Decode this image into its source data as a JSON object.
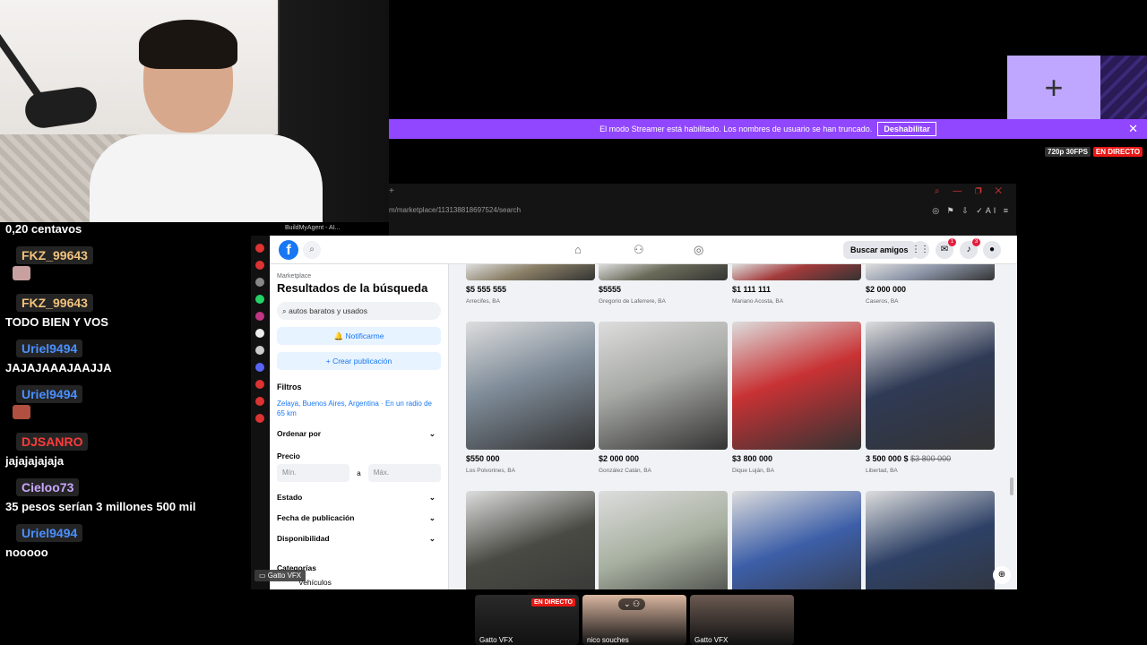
{
  "chat": [
    {
      "type": "msg",
      "text": "0,20 centavos"
    },
    {
      "type": "user",
      "text": "FKZ_99643",
      "color": "#f1c27d"
    },
    {
      "type": "emote",
      "color": "#c9a0a0"
    },
    {
      "type": "user",
      "text": "FKZ_99643",
      "color": "#f1c27d"
    },
    {
      "type": "msg",
      "text": "TODO BIEN Y VOS"
    },
    {
      "type": "user",
      "text": "Uriel9494",
      "color": "#4a90ff"
    },
    {
      "type": "msg",
      "text": "JAJAJAAAJAAJJA"
    },
    {
      "type": "user",
      "text": "Uriel9494",
      "color": "#4a90ff"
    },
    {
      "type": "emote",
      "color": "#b05040"
    },
    {
      "type": "user",
      "text": "DJSANRO",
      "color": "#ff3b3b"
    },
    {
      "type": "msg",
      "text": "jajajajajaja"
    },
    {
      "type": "user",
      "text": "Cieloo73",
      "color": "#c9a7ff"
    },
    {
      "type": "msg",
      "text": "35 pesos serían 3 millones 500 mil"
    },
    {
      "type": "user",
      "text": "Uriel9494",
      "color": "#4a90ff"
    },
    {
      "type": "msg",
      "text": "nooooo"
    }
  ],
  "streamer_bar": {
    "text": "El modo Streamer está habilitado. Los nombres de usuario se han truncado.",
    "button": "Deshabilitar"
  },
  "stream_quality": {
    "resolution": "720p 30FPS",
    "live": "EN DIRECTO"
  },
  "browser": {
    "url": "m/marketplace/113138818697524/search",
    "tab_title": "BuildMyAgent - AI..."
  },
  "facebook": {
    "logo": "f",
    "find_friends": "Buscar amigos",
    "messenger_badge": "1",
    "notif_badge": "3",
    "sidebar": {
      "section": "Marketplace",
      "title": "Resultados de la búsqueda",
      "search_value": "autos baratos y usados",
      "notify_button": "Notificarme",
      "create_button": "+ Crear publicación",
      "filters_label": "Filtros",
      "location": "Zelaya, Buenos Aires, Argentina · En un radio de 65 km",
      "sort_label": "Ordenar por",
      "price_label": "Precio",
      "price_min": "Mín.",
      "price_sep": "a",
      "price_max": "Máx.",
      "condition_label": "Estado",
      "date_label": "Fecha de publicación",
      "availability_label": "Disponibilidad",
      "categories_label": "Categorías",
      "vehicles_label": "Vehículos"
    },
    "listings_row1": [
      {
        "price": "$5 555 555",
        "city": "Arrecifes, BA",
        "color": "#8a7f66"
      },
      {
        "price": "$5555",
        "city": "Gregorio de Laferrere, BA",
        "color": "#6b6b5a"
      },
      {
        "price": "$1 111 111",
        "city": "Mariano Acosta, BA",
        "color": "#a33a3a"
      },
      {
        "price": "$2 000 000",
        "city": "Caseros, BA",
        "color": "#8d96a8"
      }
    ],
    "listings_row2": [
      {
        "price": "$550 000",
        "city": "Los Polvorines, BA",
        "color": "#7f8c99"
      },
      {
        "price": "$2 000 000",
        "city": "González Catán, BA",
        "color": "#a7a9a5"
      },
      {
        "price": "$3 800 000",
        "city": "Dique Luján, BA",
        "color": "#c83234"
      },
      {
        "price": "3 500 000 $",
        "old_price": "$3 800 000",
        "city": "Libertad, BA",
        "color": "#2f3a55"
      }
    ],
    "listings_row3": [
      {
        "color": "#4a4a44"
      },
      {
        "color": "#a7b0a0"
      },
      {
        "color": "#3d5fa8"
      },
      {
        "color": "#2e4166"
      }
    ]
  },
  "overlay": {
    "gatto_tag": "Gatto VFX",
    "thumbs": [
      {
        "label": "Gatto VFX",
        "live": "EN DIRECTO",
        "color": "#2a2a2a"
      },
      {
        "label": "nico souches",
        "color": "#d9b6a0"
      },
      {
        "label": "Gatto VFX",
        "color": "#6b5a52"
      }
    ]
  }
}
